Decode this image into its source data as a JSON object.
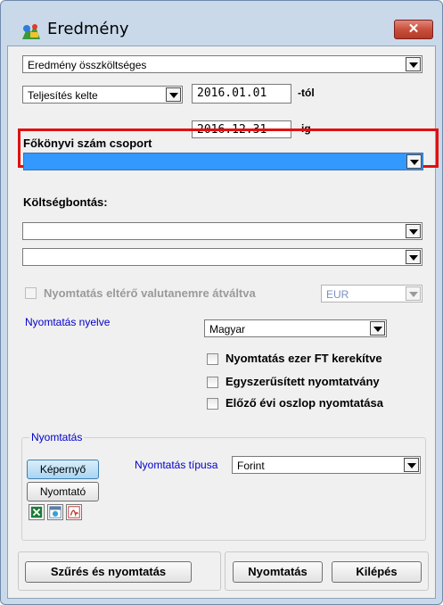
{
  "window": {
    "title": "Eredmény",
    "close_label": "✕"
  },
  "report_type": {
    "value": "Eredmény összköltséges"
  },
  "date_filter": {
    "type_value": "Teljesítés kelte",
    "from": "2016.01.01",
    "from_suffix": "-tól",
    "to": "2016.12.31",
    "to_suffix": "-ig"
  },
  "ledger_group": {
    "label": "Főkönyvi szám csoport",
    "value": ""
  },
  "cost_breakdown": {
    "label": "Költségbontás:",
    "value1": "",
    "value2": ""
  },
  "currency": {
    "label": "Nyomtatás eltérő valutanemre átváltva",
    "value": "EUR",
    "checked": false
  },
  "language": {
    "label": "Nyomtatás nyelve",
    "value": "Magyar"
  },
  "options": [
    {
      "label": "Nyomtatás ezer FT kerekítve",
      "checked": false
    },
    {
      "label": "Egyszerűsített nyomtatvány",
      "checked": false
    },
    {
      "label": "Előző évi oszlop nyomtatása",
      "checked": false
    }
  ],
  "print_group": {
    "legend": "Nyomtatás",
    "screen_label": "Képernyő",
    "printer_label": "Nyomtató",
    "type_label": "Nyomtatás típusa",
    "type_value": "Forint"
  },
  "icons": [
    "excel-icon",
    "html-icon",
    "pdf-icon"
  ],
  "footer": {
    "filter_print": "Szűrés és nyomtatás",
    "print": "Nyomtatás",
    "exit": "Kilépés"
  },
  "colors": {
    "highlight": "#3399ff",
    "focus_border": "#e01010",
    "label_blue": "#0000cc"
  }
}
